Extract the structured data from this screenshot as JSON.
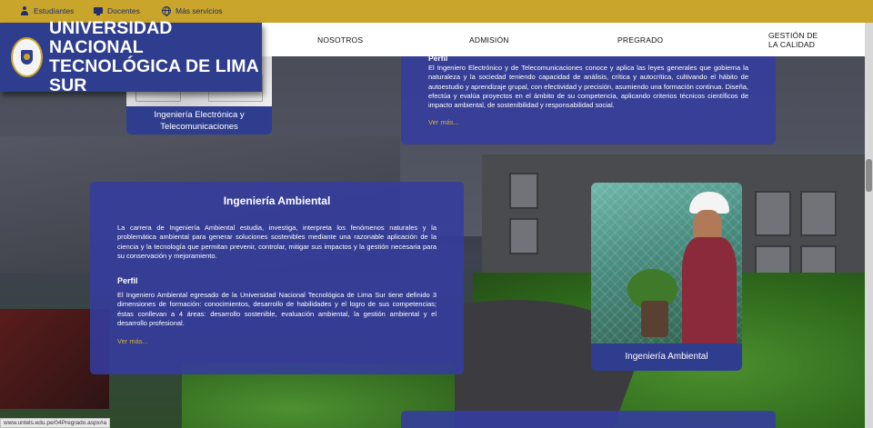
{
  "topbar": {
    "links": [
      {
        "label": "Estudiantes",
        "icon": "person-icon"
      },
      {
        "label": "Docentes",
        "icon": "teacher-icon"
      },
      {
        "label": "Más servicios",
        "icon": "globe-icon"
      }
    ]
  },
  "logo": {
    "line1": "UNIVERSIDAD NACIONAL",
    "line2": "TECNOLÓGICA DE LIMA SUR"
  },
  "nav": {
    "items": [
      "NOSOTROS",
      "ADMISIÓN",
      "PREGRADO"
    ],
    "quality_line1": "GESTIÓN DE",
    "quality_line2": "LA CALIDAD"
  },
  "electronica_card": {
    "caption_line1": "Ingeniería Electrónica y",
    "caption_line2": "Telecomunicaciones"
  },
  "electronica_info": {
    "perfil_heading": "Perfil",
    "perfil_text": "El Ingeniero Electrónico y de Telecomunicaciones conoce y aplica las leyes generales que gobierna la naturaleza y la sociedad teniendo capacidad de análisis, crítica y autocrítica, cultivando el hábito de autoestudio y aprendizaje grupal, con efectividad y precisión, asumiendo una formación continua. Diseña, efectúa y evalúa proyectos en el ámbito de su competencia, aplicando criterios técnicos científicos de impacto ambiental, de sostenibilidad y responsabilidad social.",
    "more": "Ver más..."
  },
  "ambiental_info": {
    "title": "Ingeniería Ambiental",
    "description": "La carrera de Ingeniería Ambiental estudia, investiga, interpreta los fenómenos naturales y la problemática ambiental para generar soluciones sostenibles mediante una razonable aplicación de la ciencia y la tecnología que permitan prevenir, controlar, mitigar sus impactos y la gestión necesaria para su conservación y mejoramiento.",
    "perfil_heading": "Perfil",
    "perfil_text": "El Ingeniero Ambiental egresado de la Universidad Nacional Tecnológica de Lima Sur tiene definido 3 dimensiones de formación: conocimientos, desarrollo de habilidades y el logro de sus competencias; éstas conllevan a 4 áreas: desarrollo sostenible, evaluación ambiental, la gestión ambiental y el desarrollo profesional.",
    "more": "Ver más..."
  },
  "ambiental_card": {
    "caption": "Ingeniería Ambiental"
  },
  "status_bar": {
    "url": "www.untels.edu.pe/04Pregrado.aspx#a"
  },
  "colors": {
    "gold": "#c9a52c",
    "navy": "#2f3d8f",
    "card_blue": "#343c9e",
    "link_gold": "#d4b23c"
  }
}
